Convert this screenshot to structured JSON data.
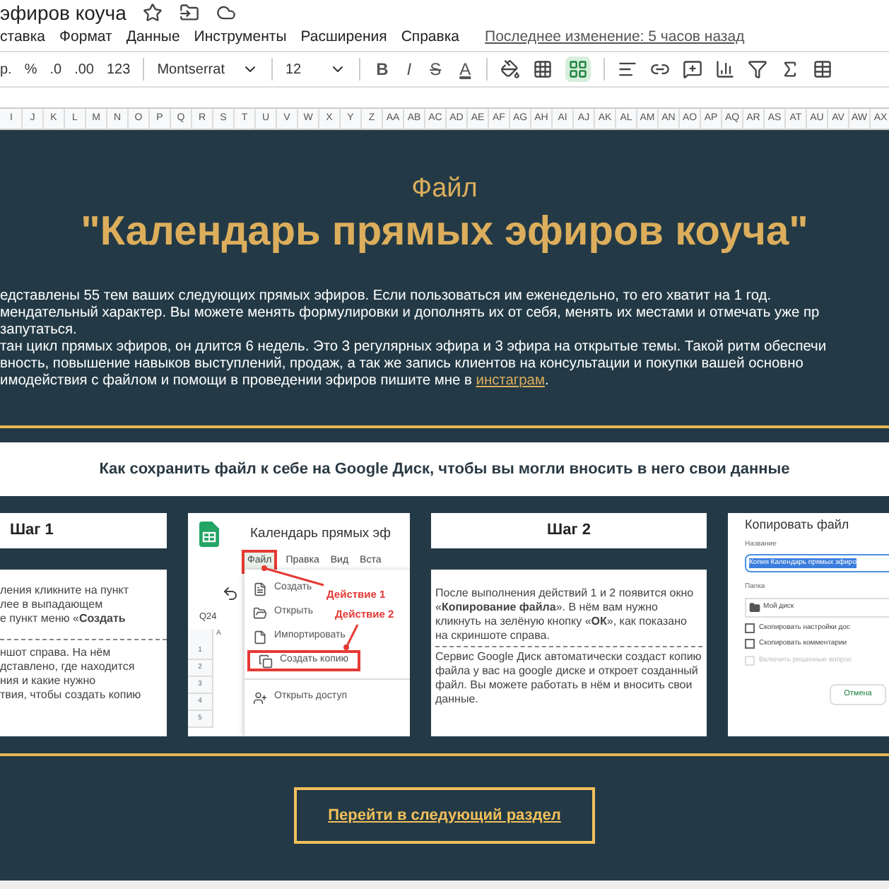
{
  "doc": {
    "title": "эфиров коуча"
  },
  "menu": {
    "items": [
      "ставка",
      "Формат",
      "Данные",
      "Инструменты",
      "Расширения",
      "Справка"
    ],
    "last_edit": "Последнее изменение: 5 часов назад"
  },
  "toolbar": {
    "number_formats": [
      "р.",
      "%",
      ".0",
      ".00",
      "123"
    ],
    "font": "Montserrat",
    "size": "12",
    "format_buttons": [
      "B",
      "I",
      "S",
      "A"
    ],
    "merge": {
      "selected": true
    }
  },
  "columns": [
    "I",
    "J",
    "K",
    "L",
    "M",
    "N",
    "O",
    "P",
    "Q",
    "R",
    "S",
    "T",
    "U",
    "V",
    "W",
    "X",
    "Y",
    "Z",
    "AA",
    "AB",
    "AC",
    "AD",
    "AE",
    "AF",
    "AG",
    "AH",
    "AI",
    "AJ",
    "AK",
    "AL",
    "AM",
    "AN",
    "AO",
    "AP",
    "AQ",
    "AR",
    "AS",
    "AT",
    "AU",
    "AV",
    "AW",
    "AX"
  ],
  "hero": {
    "kicker": "Файл",
    "title": "\"Календарь прямых эфиров коуча\"",
    "lines": [
      "едставлены 55 тем ваших следующих прямых эфиров. Если пользоваться им еженедельно, то его хватит на 1 год.",
      "мендательный характер. Вы можете менять формулировки и дополнять их от себя, менять их местами и отмечать уже пр",
      "запутаться.",
      "тан цикл прямых эфиров, он длится 6 недель. Это 3 регулярных эфира и 3 эфира на открытые темы. Такой ритм обеспечи",
      "вность, повышение навыков выступлений, продаж, а так же запись клиентов на консультации и покупки вашей основно"
    ],
    "last_line": "имодействия с файлом и помощи в проведении эфиров пишите мне в ",
    "link": "инстаграм",
    "last_end": "."
  },
  "howto": {
    "heading": "Как сохранить файл к себе на Google Диск, чтобы вы могли вносить в него свои данные"
  },
  "step1": {
    "title": "Шаг 1",
    "para1": [
      "ления кликните на пункт",
      "лее в выпадающем",
      "е пункт меню «**Создать**"
    ],
    "para2": [
      "ншот справа. На нём",
      "дставлено, где находится",
      "ния и какие нужно",
      "твия, чтобы создать копию"
    ]
  },
  "screenshot1": {
    "title": "Календарь прямых эф",
    "menu": [
      {
        "label": "Файл",
        "highlighted": true
      },
      {
        "label": "Правка",
        "highlighted": false
      },
      {
        "label": "Вид",
        "highlighted": false
      },
      {
        "label": "Вста",
        "highlighted": false
      }
    ],
    "cell": "Q24",
    "column": "A",
    "rows": [
      "1",
      "2",
      "3",
      "4",
      "5"
    ],
    "items": [
      {
        "label": "Создать",
        "highlighted": false
      },
      {
        "label": "Открыть",
        "highlighted": false
      },
      {
        "label": "Импортировать",
        "highlighted": false
      },
      {
        "label": "Создать копию",
        "highlighted": true
      },
      {
        "label": "Открыть доступ",
        "highlighted": false
      }
    ],
    "annotations": [
      "Действие 1",
      "Действие 2"
    ]
  },
  "step2": {
    "title": "Шаг 2",
    "para1": "После выполнения действий 1 и 2 появится окно «**Копирование файла**». В нём вам нужно кликнуть на зелёную кнопку «**ОК**», как показано на скриншоте справа.",
    "para2": "Сервис Google Диск автоматически создаст копию файла у вас на google диске и откроет созданный файл. Вы можете работать в нём и вносить свои данные."
  },
  "screenshot2": {
    "title": "Копировать файл",
    "name_label": "Название",
    "name_value": "Копия Календарь прямых эфиро",
    "folder_label": "Папка",
    "folder": "Мой диск",
    "options": [
      {
        "label": "Скопировать настройки дос",
        "checked": false,
        "disabled": false
      },
      {
        "label": "Скопировать комментарии",
        "checked": false,
        "disabled": false
      },
      {
        "label": "Включить решенные вопрос",
        "checked": false,
        "disabled": true
      }
    ],
    "cancel": "Отмена"
  },
  "next_button": "Перейти в следующий раздел"
}
